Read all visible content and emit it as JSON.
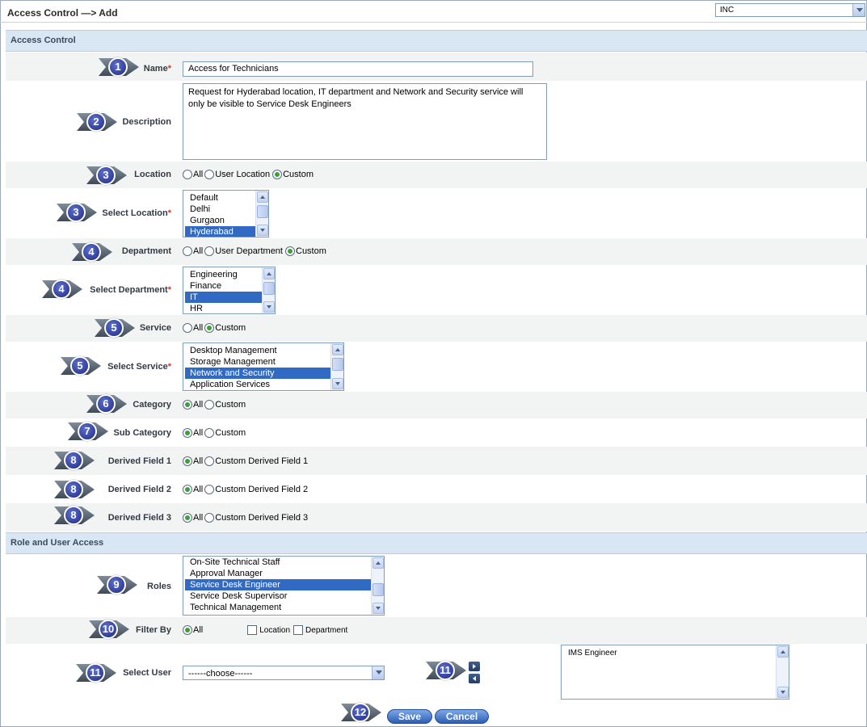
{
  "page": {
    "title": "Access Control —> Add"
  },
  "instance_select": {
    "value": "INC"
  },
  "sections": {
    "access_control": "Access Control",
    "role_user": "Role and User Access"
  },
  "badges": [
    "1",
    "2",
    "3",
    "3",
    "4",
    "4",
    "5",
    "5",
    "6",
    "7",
    "8",
    "8",
    "8",
    "9",
    "10",
    "11",
    "11",
    "12"
  ],
  "form": {
    "name": {
      "label": "Name",
      "required_mark": "*",
      "value": "Access for Technicians"
    },
    "description": {
      "label": "Description",
      "value": "Request for Hyderabad location, IT department and Network and Security service will only be visible to Service Desk Engineers"
    },
    "location": {
      "label": "Location",
      "options": [
        "All",
        "User Location",
        "Custom"
      ],
      "selected": "Custom"
    },
    "select_location": {
      "label": "Select Location",
      "required_mark": "*",
      "items": [
        "Default",
        "Delhi",
        "Gurgaon",
        "Hyderabad"
      ],
      "selected": "Hyderabad"
    },
    "department": {
      "label": "Department",
      "options": [
        "All",
        "User Department",
        "Custom"
      ],
      "selected": "Custom"
    },
    "select_department": {
      "label": "Select Department",
      "required_mark": "*",
      "items": [
        "Engineering",
        "Finance",
        "IT",
        "HR"
      ],
      "selected": "IT"
    },
    "service": {
      "label": "Service",
      "options": [
        "All",
        "Custom"
      ],
      "selected": "Custom"
    },
    "select_service": {
      "label": "Select Service",
      "required_mark": "*",
      "items": [
        "Desktop Management",
        "Storage Management",
        "Network and Security",
        "Application Services"
      ],
      "selected": "Network and Security"
    },
    "category": {
      "label": "Category",
      "options": [
        "All",
        "Custom"
      ],
      "selected": "All"
    },
    "sub_category": {
      "label": "Sub Category",
      "options": [
        "All",
        "Custom"
      ],
      "selected": "All"
    },
    "derived_field_1": {
      "label": "Derived Field 1",
      "options": [
        "All",
        "Custom Derived Field 1"
      ],
      "selected": "All"
    },
    "derived_field_2": {
      "label": "Derived Field 2",
      "options": [
        "All",
        "Custom Derived Field 2"
      ],
      "selected": "All"
    },
    "derived_field_3": {
      "label": "Derived Field 3",
      "options": [
        "All",
        "Custom Derived Field 3"
      ],
      "selected": "All"
    },
    "roles": {
      "label": "Roles",
      "items": [
        "On-Site Technical Staff",
        "Approval Manager",
        "Service Desk Engineer",
        "Service Desk Supervisor",
        "Technical Management"
      ],
      "selected": "Service Desk Engineer"
    },
    "filter_by": {
      "label": "Filter By",
      "radio": "All",
      "checkboxes": [
        "Location",
        "Department"
      ]
    },
    "select_user": {
      "label": "Select User",
      "value": "------choose------"
    },
    "selected_users": {
      "items": [
        "IMS Engineer"
      ]
    }
  },
  "buttons": {
    "save": "Save",
    "cancel": "Cancel"
  },
  "colors": {
    "accent": "#316ac5",
    "section_bg": "#d9e6f4",
    "required": "#d0392b",
    "radio_on": "#3aa13a"
  }
}
